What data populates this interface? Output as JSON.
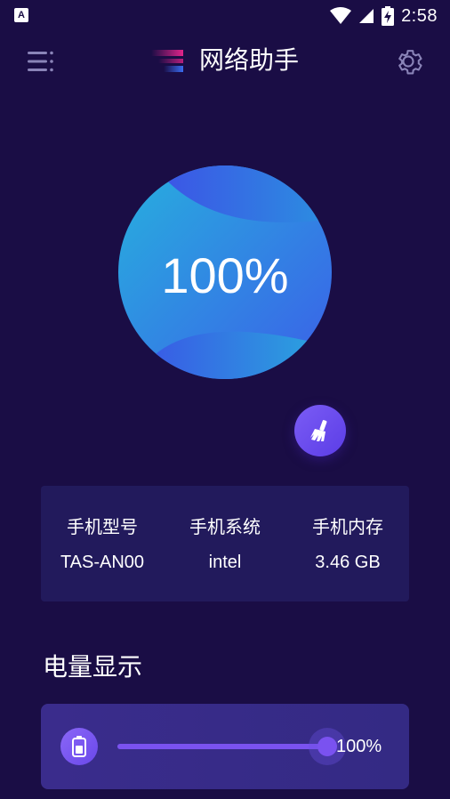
{
  "status_bar": {
    "notification_icon": "font-a-icon",
    "icons": [
      "wifi-icon",
      "signal-icon",
      "battery-charging-icon"
    ],
    "time": "2:58"
  },
  "header": {
    "menu_icon": "menu-icon",
    "logo_icon": "app-logo-icon",
    "title": "网络助手",
    "settings_icon": "gear-icon"
  },
  "gauge": {
    "value": "100%",
    "colors": {
      "primary": "#2b9fe0",
      "secondary": "#3f63e8"
    }
  },
  "clean_button": {
    "icon": "broom-icon",
    "color": "#6a4cf0"
  },
  "device_info": {
    "items": [
      {
        "label": "手机型号",
        "value": "TAS-AN00"
      },
      {
        "label": "手机系统",
        "value": "intel"
      },
      {
        "label": "手机内存",
        "value": "3.46 GB"
      }
    ]
  },
  "battery": {
    "section_title": "电量显示",
    "icon": "battery-icon",
    "level": 1.0,
    "percent_label": "100%",
    "accent_color": "#7a52f0"
  },
  "colors": {
    "background": "#1a0d45",
    "card": "#221a5c",
    "battery_card": "#3a2c8c"
  }
}
